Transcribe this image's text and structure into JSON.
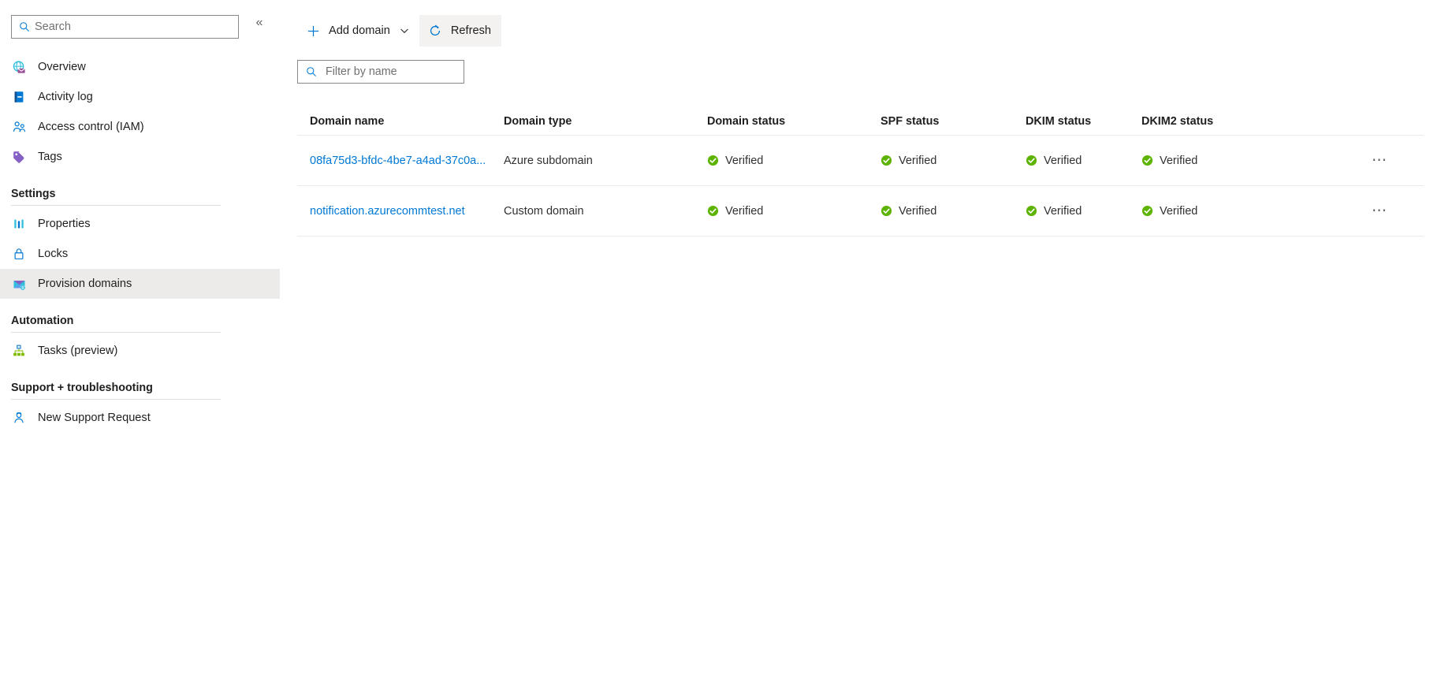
{
  "sidebar": {
    "search": {
      "placeholder": "Search",
      "value": "",
      "icon": "search-icon"
    },
    "collapse": {
      "icon": "chevron-double-left-icon",
      "glyph": "«"
    },
    "top_items": [
      {
        "label": "Overview",
        "icon": "overview-icon"
      },
      {
        "label": "Activity log",
        "icon": "activity-log-icon"
      },
      {
        "label": "Access control (IAM)",
        "icon": "access-control-icon"
      },
      {
        "label": "Tags",
        "icon": "tags-icon"
      }
    ],
    "groups": [
      {
        "title": "Settings",
        "items": [
          {
            "label": "Properties",
            "icon": "properties-icon",
            "selected": false
          },
          {
            "label": "Locks",
            "icon": "lock-icon",
            "selected": false
          },
          {
            "label": "Provision domains",
            "icon": "provision-domains-icon",
            "selected": true
          }
        ]
      },
      {
        "title": "Automation",
        "items": [
          {
            "label": "Tasks (preview)",
            "icon": "tasks-icon",
            "selected": false
          }
        ]
      },
      {
        "title": "Support + troubleshooting",
        "items": [
          {
            "label": "New Support Request",
            "icon": "support-request-icon",
            "selected": false
          }
        ]
      }
    ]
  },
  "toolbar": {
    "add_domain": {
      "label": "Add domain",
      "icon": "plus-icon",
      "chevron": "chevron-down-icon"
    },
    "refresh": {
      "label": "Refresh",
      "icon": "refresh-icon",
      "hovered": true
    }
  },
  "filter": {
    "placeholder": "Filter by name",
    "value": "",
    "icon": "search-icon"
  },
  "table": {
    "columns": [
      "Domain name",
      "Domain type",
      "Domain status",
      "SPF status",
      "DKIM status",
      "DKIM2 status"
    ],
    "rows": [
      {
        "domain_name": "08fa75d3-bfdc-4be7-a4ad-37c0a...",
        "domain_type": "Azure subdomain",
        "domain_status": "Verified",
        "spf_status": "Verified",
        "dkim_status": "Verified",
        "dkim2_status": "Verified",
        "menu": "⋯"
      },
      {
        "domain_name": "notification.azurecommtest.net",
        "domain_type": "Custom domain",
        "domain_status": "Verified",
        "spf_status": "Verified",
        "dkim_status": "Verified",
        "dkim2_status": "Verified",
        "menu": "⋯"
      }
    ]
  },
  "colors": {
    "accent": "#0078d4",
    "link": "#0078d4",
    "verified_green": "#5db300",
    "selected_row": "#edebe9",
    "border": "#e1dfdd"
  }
}
